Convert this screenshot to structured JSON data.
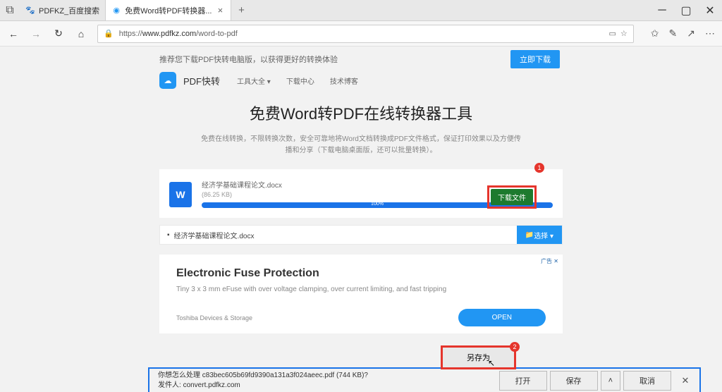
{
  "tabs": [
    {
      "title": "PDFKZ_百度搜索"
    },
    {
      "title": "免费Word转PDF转换器..."
    }
  ],
  "url": {
    "lock": "🔒",
    "scheme": "https://",
    "host": "www.pdfkz.com",
    "path": "/word-to-pdf"
  },
  "promo": {
    "text": "推荐您下载PDF快转电脑版，以获得更好的转换体验",
    "btn": "立即下载"
  },
  "site": {
    "brand": "PDF快转",
    "nav": [
      "工具大全 ▾",
      "下载中心",
      "技术博客"
    ]
  },
  "hero": {
    "title": "免费Word转PDF在线转换器工具",
    "sub": "免费在线转换，不限转换次数，安全可靠地将Word文档转换成PDF文件格式，保证打印效果以及方便传播和分享（下载电脑桌面版，还可以批量转换）。"
  },
  "file": {
    "name": "经济学基础课程论文.docx",
    "size": "(86.25 KB)",
    "progress": "100%",
    "download": "下载文件"
  },
  "filelist": {
    "item": "经济学基础课程论文.docx",
    "select": "选择 ▾"
  },
  "ad": {
    "mark": "广告 ✕",
    "title": "Electronic Fuse Protection",
    "sub": "Tiny 3 x 3 mm eFuse with over voltage clamping, over current limiting, and fast tripping",
    "brand": "Toshiba Devices & Storage",
    "open": "OPEN"
  },
  "dlbar": {
    "line1_a": "你想怎么处理 ",
    "line1_b": "c83bec605b69fd9390a131a3f024aeec.pdf (744 KB)?",
    "line2_a": "发件人: ",
    "line2_b": "convert.pdfkz.com",
    "open": "打开",
    "save": "保存",
    "cancel": "取消"
  },
  "popup": {
    "label": "另存为"
  },
  "badges": {
    "b1": "1",
    "b2": "2"
  }
}
